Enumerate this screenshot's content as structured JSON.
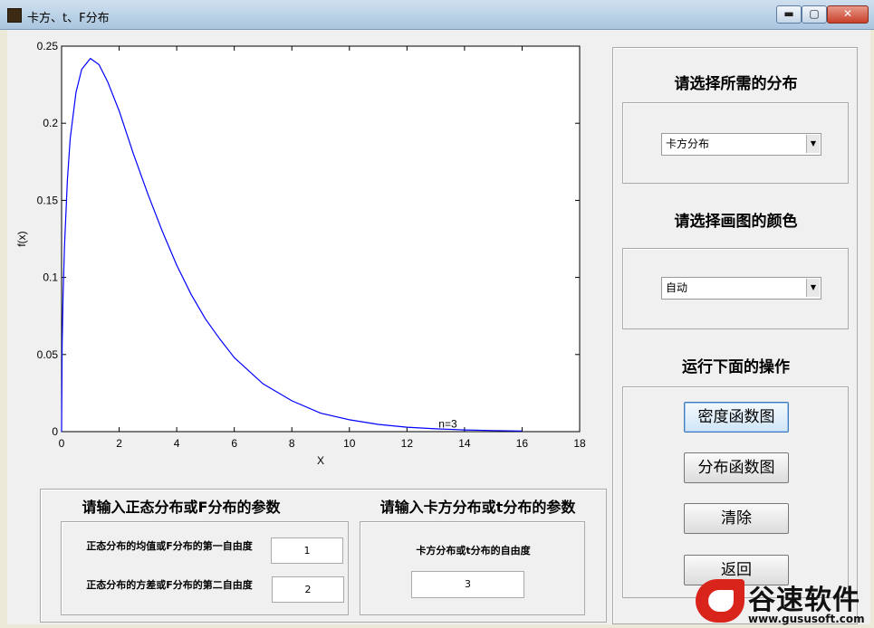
{
  "window": {
    "title": "卡方、t、F分布",
    "controls": {
      "minimize": "▬",
      "maximize": "▢",
      "close": "✕"
    }
  },
  "chart_data": {
    "type": "line",
    "xlabel": "X",
    "ylabel": "f(x)",
    "xlim": [
      0,
      18
    ],
    "ylim": [
      0,
      0.25
    ],
    "xticks": [
      0,
      2,
      4,
      6,
      8,
      10,
      12,
      14,
      16,
      18
    ],
    "yticks": [
      0,
      0.05,
      0.1,
      0.15,
      0.2,
      0.25
    ],
    "ytick_labels": [
      "0",
      "0.05",
      "0.1",
      "0.15",
      "0.2",
      "0.25"
    ],
    "annotation": {
      "text": "n=3",
      "x": 13.1,
      "y": 0.0025
    },
    "series": [
      {
        "color": "#0000ff",
        "x": [
          0.02,
          0.05,
          0.1,
          0.2,
          0.3,
          0.5,
          0.7,
          1.0,
          1.3,
          1.6,
          2.0,
          2.5,
          3.0,
          3.5,
          4.0,
          4.5,
          5.0,
          5.5,
          6.0,
          7.0,
          8.0,
          9.0,
          10.0,
          11.0,
          12.0,
          13.0,
          14.0,
          15.0,
          16.0
        ],
        "y": [
          0.056,
          0.087,
          0.12,
          0.163,
          0.19,
          0.22,
          0.235,
          0.242,
          0.238,
          0.227,
          0.208,
          0.18,
          0.154,
          0.13,
          0.108,
          0.089,
          0.073,
          0.06,
          0.048,
          0.031,
          0.02,
          0.012,
          0.0077,
          0.0047,
          0.0029,
          0.0018,
          0.0011,
          0.0007,
          0.0004
        ]
      }
    ]
  },
  "right_panel": {
    "dist_title": "请选择所需的分布",
    "dist_value": "卡方分布",
    "color_title": "请选择画图的颜色",
    "color_value": "自动",
    "ops_title": "运行下面的操作",
    "buttons": {
      "density": "密度函数图",
      "cdf": "分布函数图",
      "clear": "清除",
      "back": "返回"
    }
  },
  "bottom_panel": {
    "normal_title": "请输入正态分布或F分布的参数",
    "mean_label": "正态分布的均值或F分布的第一自由度",
    "mean_value": "1",
    "var_label": "正态分布的方差或F分布的第二自由度",
    "var_value": "2",
    "chi_title": "请输入卡方分布或t分布的参数",
    "df_label": "卡方分布或t分布的自由度",
    "df_value": "3"
  },
  "watermark": {
    "name": "谷速软件",
    "url": "www.gususoft.com"
  }
}
